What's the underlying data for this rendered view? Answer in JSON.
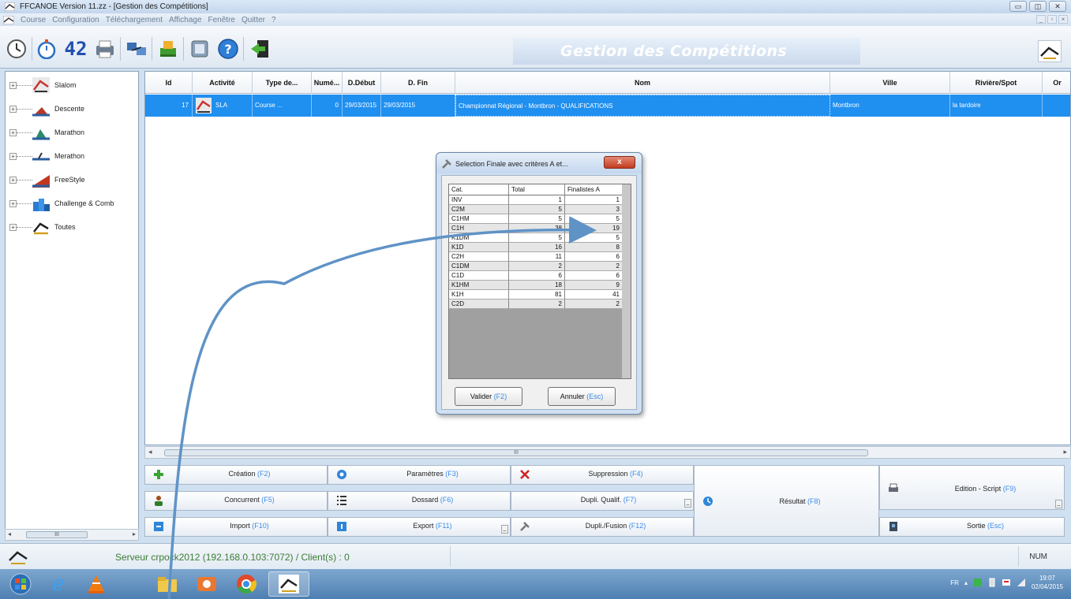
{
  "window": {
    "title": "FFCANOE Version 11.zz - [Gestion des Compétitions]"
  },
  "menu": {
    "items": [
      "Course",
      "Configuration",
      "Téléchargement",
      "Affichage",
      "Fenêtre",
      "Quitter",
      "?"
    ]
  },
  "toolbar": {
    "chrono_digits": "42",
    "page_title": "Gestion des Compétitions"
  },
  "tree": {
    "items": [
      {
        "label": "Slalom",
        "icon": "slalom-icon"
      },
      {
        "label": "Descente",
        "icon": "descente-icon"
      },
      {
        "label": "Marathon",
        "icon": "marathon-icon"
      },
      {
        "label": "Merathon",
        "icon": "merathon-icon"
      },
      {
        "label": "FreeStyle",
        "icon": "freestyle-icon"
      },
      {
        "label": "Challenge & Comb",
        "icon": "challenge-icon"
      },
      {
        "label": "Toutes",
        "icon": "toutes-icon"
      }
    ],
    "scroll_thumb": "III"
  },
  "grid": {
    "columns": [
      "Id",
      "Activité",
      "Type de...",
      "Numé...",
      "D.Début",
      "D. Fin",
      "Nom",
      "Ville",
      "Rivière/Spot",
      "Or"
    ],
    "rows": [
      {
        "id": "17",
        "activite": "SLA",
        "type": "Course ...",
        "numero": "0",
        "debut": "29/03/2015",
        "fin": "29/03/2015",
        "nom": "Championnat Régional - Montbron - QUALIFICATIONS",
        "ville": "Montbron",
        "riviere": "la tardoire"
      }
    ],
    "scroll_thumb": "III"
  },
  "actions": {
    "creation": {
      "label": "Création",
      "key": "(F2)"
    },
    "parametres": {
      "label": "Paramètres",
      "key": "(F3)"
    },
    "suppression": {
      "label": "Suppression",
      "key": "(F4)"
    },
    "concurrent": {
      "label": "Concurrent",
      "key": "(F5)"
    },
    "dossard": {
      "label": "Dossard",
      "key": "(F6)"
    },
    "dupli_qualif": {
      "label": "Dupli. Qualif.",
      "key": "(F7)"
    },
    "resultat": {
      "label": "Résultat",
      "key": "(F8)"
    },
    "edition": {
      "label": "Edition - Script",
      "key": "(F9)"
    },
    "import": {
      "label": "Import",
      "key": "(F10)"
    },
    "export": {
      "label": "Export",
      "key": "(F11)"
    },
    "dupli_fusion": {
      "label": "Dupli./Fusion",
      "key": "(F12)"
    },
    "sortie": {
      "label": "Sortie",
      "key": "(Esc)"
    }
  },
  "status": {
    "server": "Serveur crpock2012 (192.168.0.103:7072) / Client(s) : 0",
    "num": "NUM"
  },
  "taskbar": {
    "lang": "FR",
    "time": "19:07",
    "date": "02/04/2015"
  },
  "dialog": {
    "title": "Selection Finale avec critères A et...",
    "close_label": "x",
    "headers": [
      "Cat.",
      "Total",
      "Finalistes A"
    ],
    "rows": [
      {
        "cat": "INV",
        "total": "1",
        "finalistes": "1"
      },
      {
        "cat": "C2M",
        "total": "5",
        "finalistes": "3"
      },
      {
        "cat": "C1HM",
        "total": "5",
        "finalistes": "5"
      },
      {
        "cat": "C1H",
        "total": "38",
        "finalistes": "19"
      },
      {
        "cat": "K1DM",
        "total": "5",
        "finalistes": "5"
      },
      {
        "cat": "K1D",
        "total": "16",
        "finalistes": "8"
      },
      {
        "cat": "C2H",
        "total": "11",
        "finalistes": "6"
      },
      {
        "cat": "C1DM",
        "total": "2",
        "finalistes": "2"
      },
      {
        "cat": "C1D",
        "total": "6",
        "finalistes": "6"
      },
      {
        "cat": "K1HM",
        "total": "18",
        "finalistes": "9"
      },
      {
        "cat": "K1H",
        "total": "81",
        "finalistes": "41"
      },
      {
        "cat": "C2D",
        "total": "2",
        "finalistes": "2"
      }
    ],
    "valider": {
      "label": "Valider",
      "key": "(F2)"
    },
    "annuler": {
      "label": "Annuler",
      "key": "(Esc)"
    }
  },
  "colors": {
    "selection": "#1f8ff0",
    "key_hint": "#3b8be8",
    "server_text": "#3e7c35",
    "arrow": "#5f93c6"
  }
}
